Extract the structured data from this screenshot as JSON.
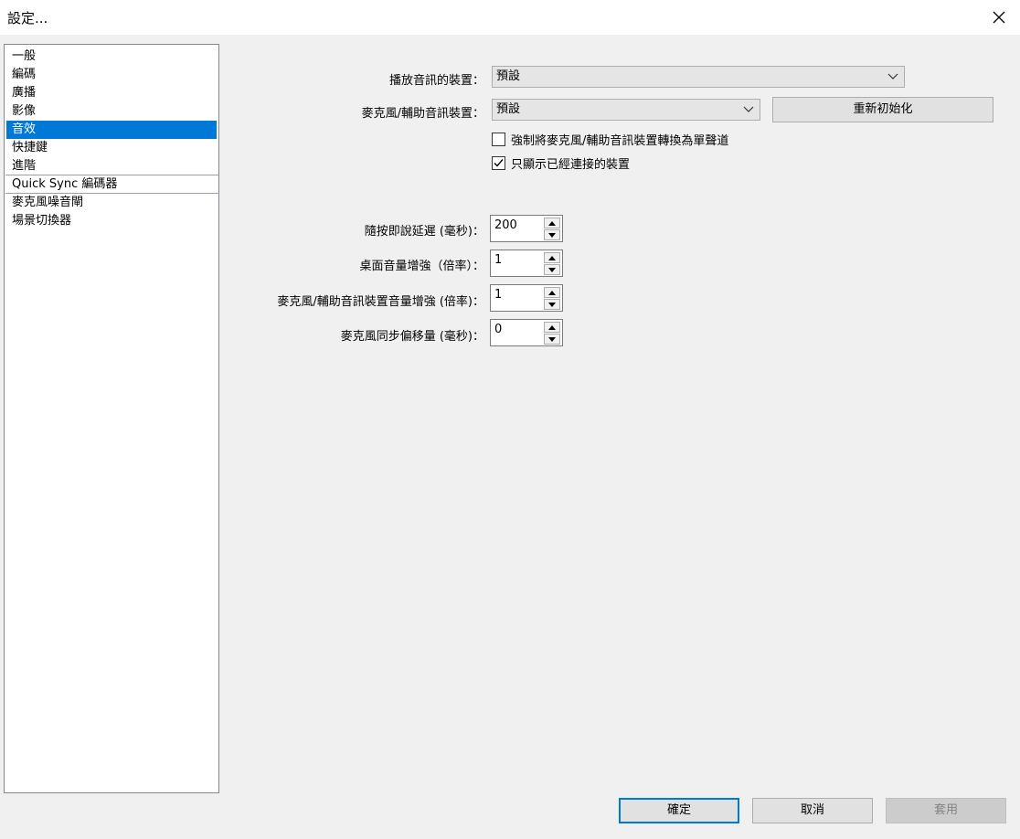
{
  "window": {
    "title": "設定..."
  },
  "sidebar": {
    "items": [
      {
        "label": "一般"
      },
      {
        "label": "編碼"
      },
      {
        "label": "廣播"
      },
      {
        "label": "影像"
      },
      {
        "label": "音效",
        "selected": true
      },
      {
        "label": "快捷鍵"
      },
      {
        "label": "進階"
      },
      {
        "label": "Quick Sync 編碼器"
      },
      {
        "label": "麥克風噪音閘"
      },
      {
        "label": "場景切換器"
      }
    ]
  },
  "audio": {
    "playback_device_label": "播放音訊的裝置：",
    "playback_device_value": "預設",
    "mic_device_label": "麥克風/輔助音訊裝置：",
    "mic_device_value": "預設",
    "reinit_button": "重新初始化",
    "force_mono_label": "強制將麥克風/輔助音訊裝置轉換為單聲道",
    "force_mono_checked": false,
    "only_connected_label": "只顯示已經連接的裝置",
    "only_connected_checked": true,
    "ptt_delay_label": "隨按即說延遲 (毫秒)：",
    "ptt_delay_value": "200",
    "desktop_boost_label": "桌面音量增強（倍率）：",
    "desktop_boost_value": "1",
    "mic_boost_label": "麥克風/輔助音訊裝置音量增強 (倍率)：",
    "mic_boost_value": "1",
    "mic_offset_label": "麥克風同步偏移量 (毫秒)：",
    "mic_offset_value": "0"
  },
  "footer": {
    "ok": "確定",
    "cancel": "取消",
    "apply": "套用"
  },
  "colors": {
    "selection": "#0078d7",
    "background": "#f0f0f0"
  }
}
